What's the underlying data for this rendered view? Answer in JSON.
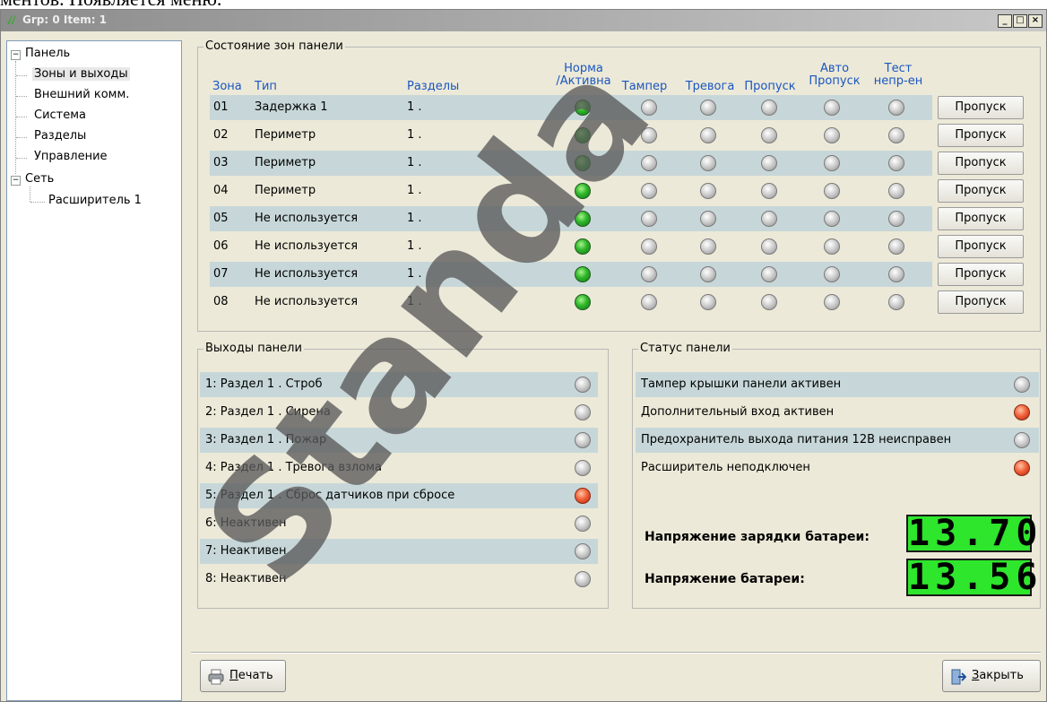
{
  "doc_fragment": "ментов. Появляется меню.",
  "window": {
    "title": "Grp: 0 Item: 1",
    "btn_min": "_",
    "btn_max": "□",
    "btn_close": "×"
  },
  "tree": {
    "panel": "Панель",
    "panel_children": [
      "Зоны и выходы",
      "Внешний комм.",
      "Система",
      "Разделы",
      "Управление"
    ],
    "network": "Сеть",
    "network_children": [
      "Расширитель 1"
    ],
    "expander": "−"
  },
  "zones": {
    "title": "Состояние зон панели",
    "headers": {
      "zone": "Зона",
      "type": "Тип",
      "partitions": "Разделы",
      "normal_l1": "Норма",
      "normal_l2": "/Активна",
      "tamper": "Тампер",
      "alarm": "Тревога",
      "bypass": "Пропуск",
      "auto_l1": "Авто",
      "auto_l2": "Пропуск",
      "test_l1": "Тест",
      "test_l2": "непр-ен"
    },
    "rows": [
      {
        "num": "01",
        "type": "Задержка 1",
        "part": "1 .",
        "leds": [
          "green",
          "gray",
          "gray",
          "gray",
          "gray",
          "gray"
        ],
        "button": "Пропуск"
      },
      {
        "num": "02",
        "type": "Периметр",
        "part": "1 .",
        "leds": [
          "green",
          "gray",
          "gray",
          "gray",
          "gray",
          "gray"
        ],
        "button": "Пропуск"
      },
      {
        "num": "03",
        "type": "Периметр",
        "part": "1 .",
        "leds": [
          "green",
          "gray",
          "gray",
          "gray",
          "gray",
          "gray"
        ],
        "button": "Пропуск"
      },
      {
        "num": "04",
        "type": "Периметр",
        "part": "1 .",
        "leds": [
          "green",
          "gray",
          "gray",
          "gray",
          "gray",
          "gray"
        ],
        "button": "Пропуск"
      },
      {
        "num": "05",
        "type": "Не используется",
        "part": "1 .",
        "leds": [
          "green",
          "gray",
          "gray",
          "gray",
          "gray",
          "gray"
        ],
        "button": "Пропуск"
      },
      {
        "num": "06",
        "type": "Не используется",
        "part": "1 .",
        "leds": [
          "green",
          "gray",
          "gray",
          "gray",
          "gray",
          "gray"
        ],
        "button": "Пропуск"
      },
      {
        "num": "07",
        "type": "Не используется",
        "part": "1 .",
        "leds": [
          "green",
          "gray",
          "gray",
          "gray",
          "gray",
          "gray"
        ],
        "button": "Пропуск"
      },
      {
        "num": "08",
        "type": "Не используется",
        "part": "1 .",
        "leds": [
          "green",
          "gray",
          "gray",
          "gray",
          "gray",
          "gray"
        ],
        "button": "Пропуск"
      }
    ]
  },
  "outputs": {
    "title": "Выходы панели",
    "rows": [
      {
        "label": "1: Раздел 1 . Строб",
        "led": "gray"
      },
      {
        "label": "2: Раздел 1 . Сирена",
        "led": "gray"
      },
      {
        "label": "3: Раздел 1 . Пожар",
        "led": "gray"
      },
      {
        "label": "4: Раздел 1 . Тревога взлома",
        "led": "gray"
      },
      {
        "label": "5: Раздел 1 . Сброс датчиков при сбросе",
        "led": "red"
      },
      {
        "label": "6: Неактивен",
        "led": "gray"
      },
      {
        "label": "7: Неактивен",
        "led": "gray"
      },
      {
        "label": "8: Неактивен",
        "led": "gray"
      }
    ]
  },
  "status": {
    "title": "Статус панели",
    "rows": [
      {
        "label": "Тампер крышки панели активен",
        "led": "gray"
      },
      {
        "label": "Дополнительный вход активен",
        "led": "red"
      },
      {
        "label": "Предохранитель выхода питания 12В неисправен",
        "led": "gray"
      },
      {
        "label": "Расширитель неподключен",
        "led": "red"
      }
    ],
    "charge_label": "Напряжение зарядки батареи:",
    "charge_value": "13.70",
    "battery_label": "Напряжение батареи:",
    "battery_value": "13.56"
  },
  "footer": {
    "print_pre": "",
    "print_u": "П",
    "print_rest": "ечать",
    "close_u": "З",
    "close_rest": "акрыть"
  },
  "watermark": "Standa",
  "colors": {
    "row_shade": "#c7d7d9",
    "header_blue": "#1a56c0",
    "lcd_green": "#2ee62c",
    "window_bg": "#ece9d8"
  }
}
